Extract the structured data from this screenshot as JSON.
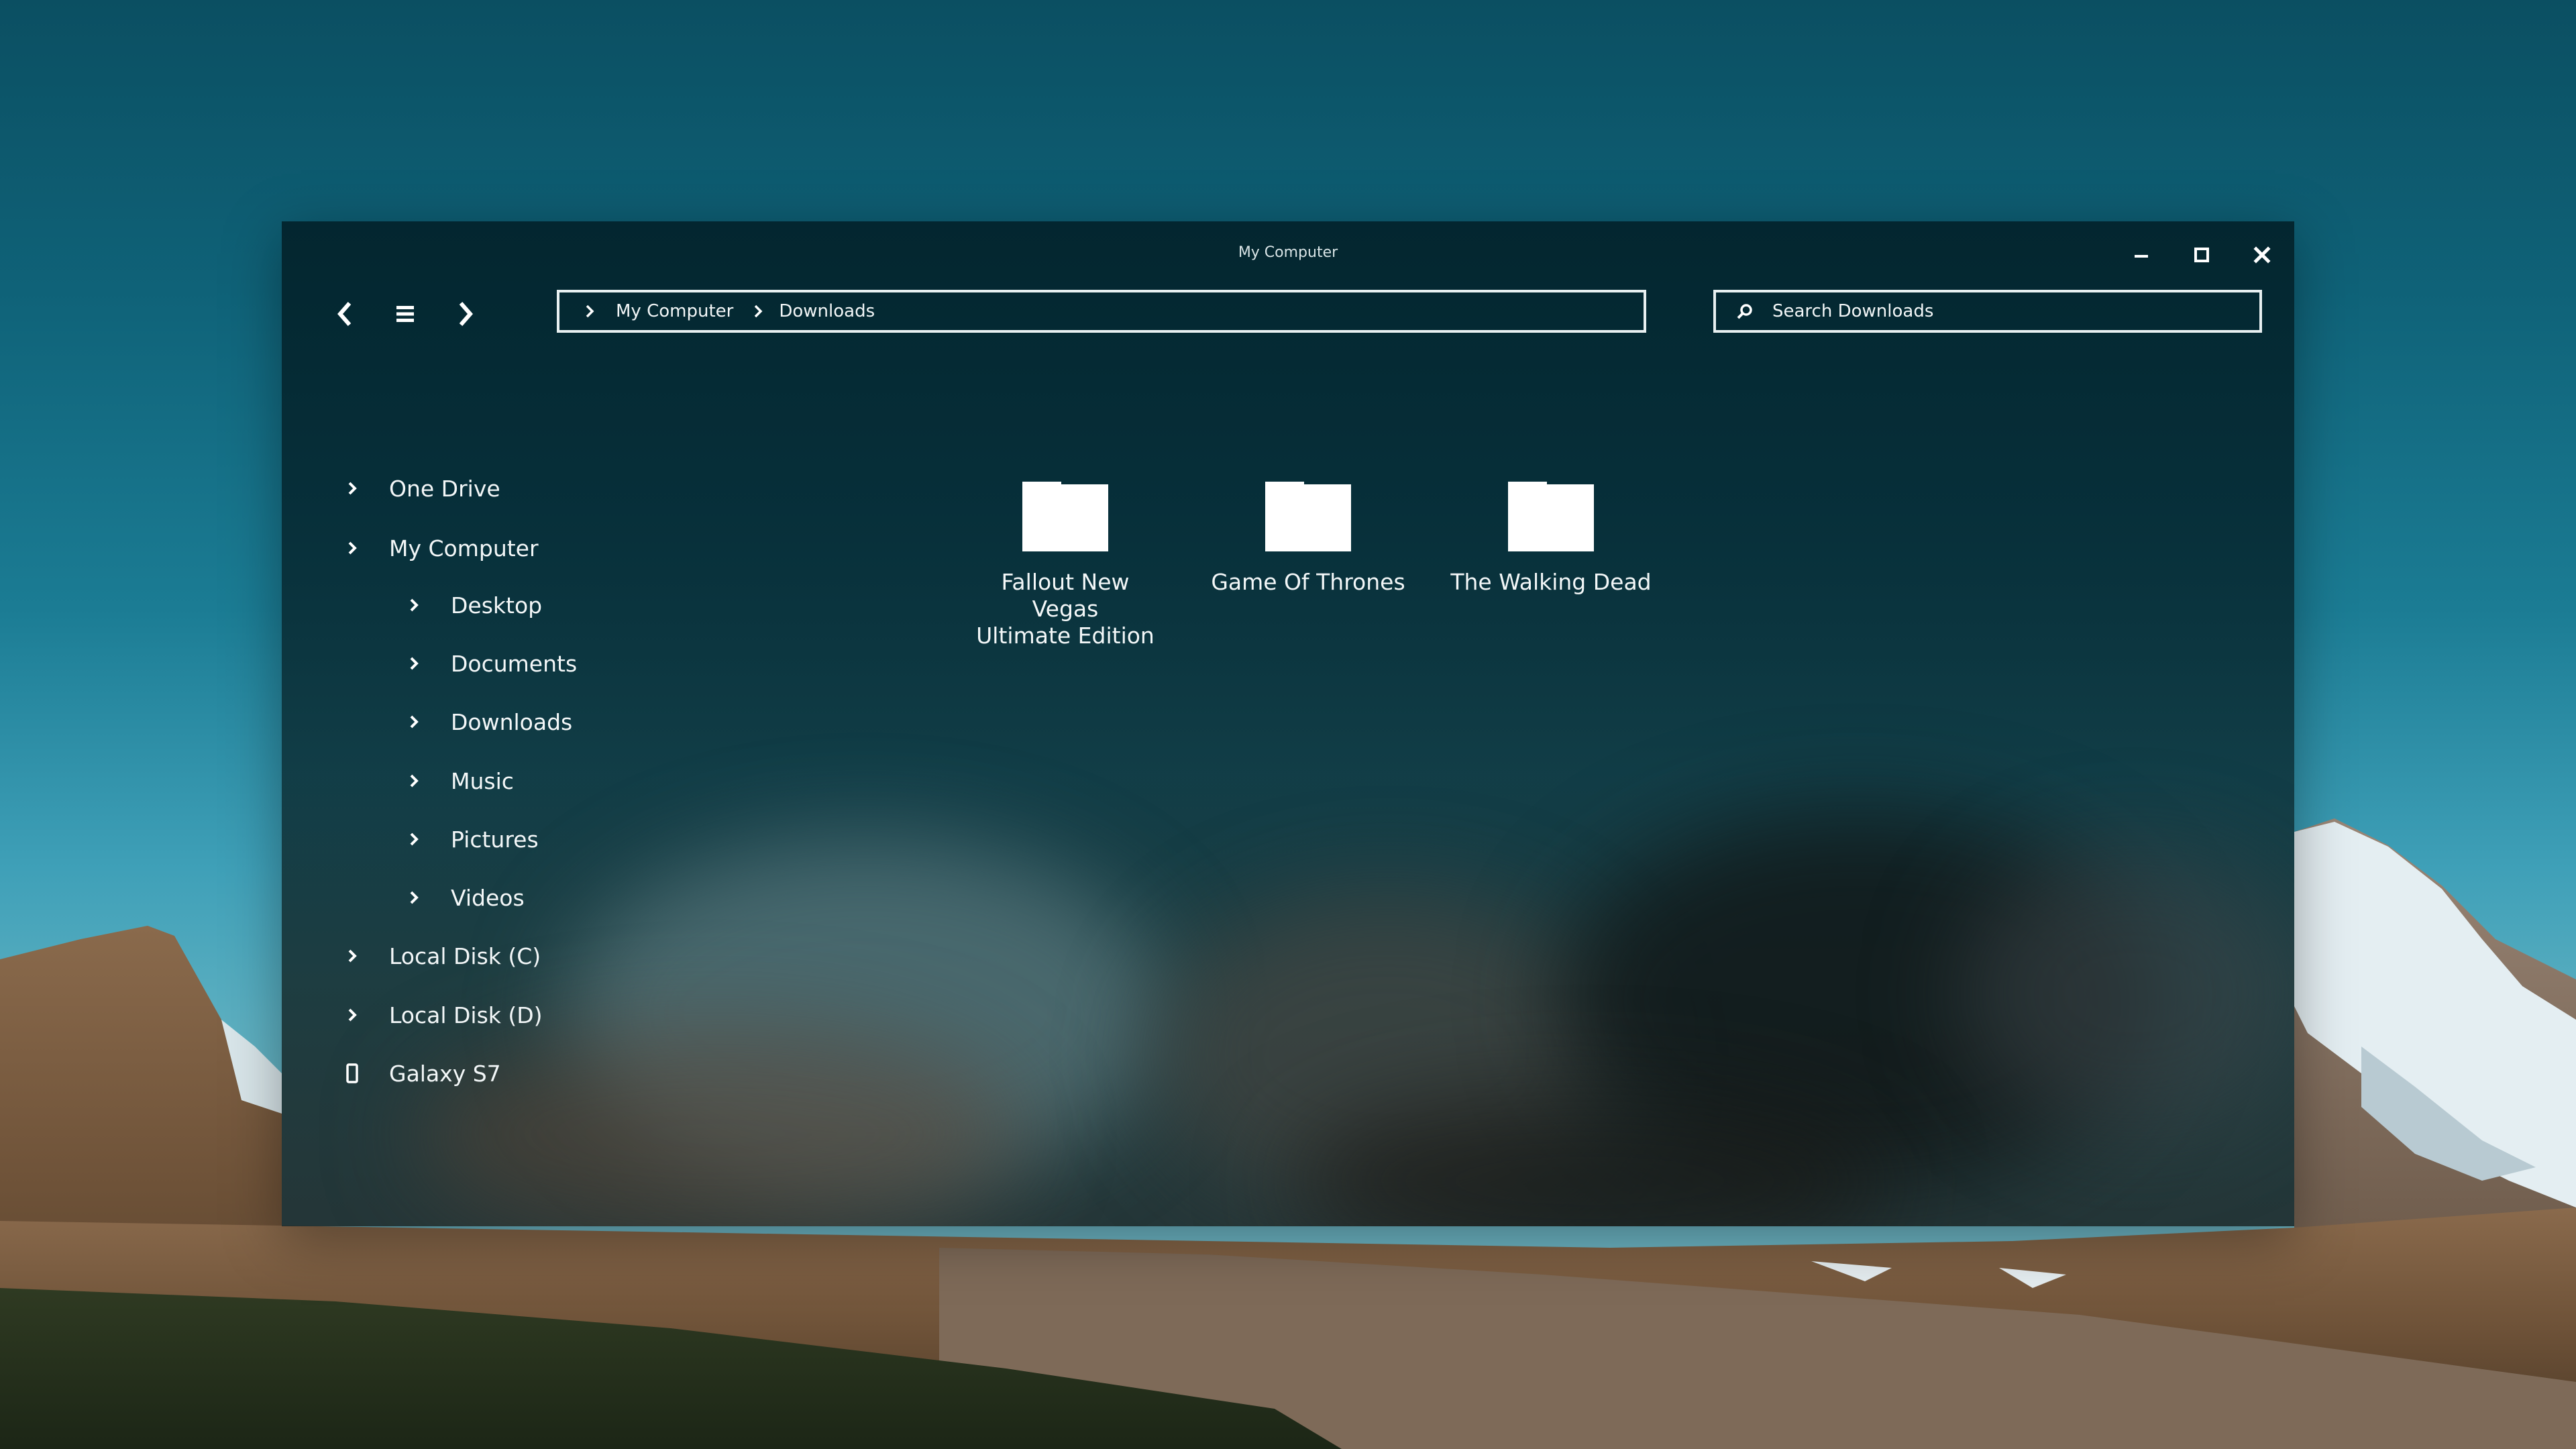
{
  "window": {
    "title": "My Computer"
  },
  "toolbar": {
    "back_icon": "chevron-left-icon",
    "menu_icon": "hamburger-menu-icon",
    "forward_icon": "chevron-right-icon"
  },
  "address": {
    "crumbs": [
      "My Computer",
      "Downloads"
    ]
  },
  "search": {
    "placeholder": "Search Downloads",
    "value": ""
  },
  "sidebar": {
    "items": [
      {
        "label": "One Drive",
        "icon": "chevron-right-icon",
        "level": 0
      },
      {
        "label": "My Computer",
        "icon": "chevron-right-icon",
        "level": 0
      },
      {
        "label": "Desktop",
        "icon": "chevron-right-icon",
        "level": 1
      },
      {
        "label": "Documents",
        "icon": "chevron-right-icon",
        "level": 1
      },
      {
        "label": "Downloads",
        "icon": "chevron-right-icon",
        "level": 1
      },
      {
        "label": "Music",
        "icon": "chevron-right-icon",
        "level": 1
      },
      {
        "label": "Pictures",
        "icon": "chevron-right-icon",
        "level": 1
      },
      {
        "label": "Videos",
        "icon": "chevron-right-icon",
        "level": 1
      },
      {
        "label": "Local Disk (C)",
        "icon": "chevron-right-icon",
        "level": 0
      },
      {
        "label": "Local Disk (D)",
        "icon": "chevron-right-icon",
        "level": 0
      },
      {
        "label": "Galaxy S7",
        "icon": "phone-icon",
        "level": 0
      }
    ]
  },
  "content": {
    "folders": [
      {
        "name_line1": "Fallout New Vegas",
        "name_line2": "Ultimate Edition",
        "icon": "folder-icon"
      },
      {
        "name_line1": "Game Of Thrones",
        "name_line2": "",
        "icon": "folder-icon"
      },
      {
        "name_line1": "The Walking Dead",
        "name_line2": "",
        "icon": "folder-icon"
      }
    ]
  },
  "colors": {
    "window_bg": "#042630",
    "text": "#ffffff",
    "sky": "#0f6278"
  }
}
